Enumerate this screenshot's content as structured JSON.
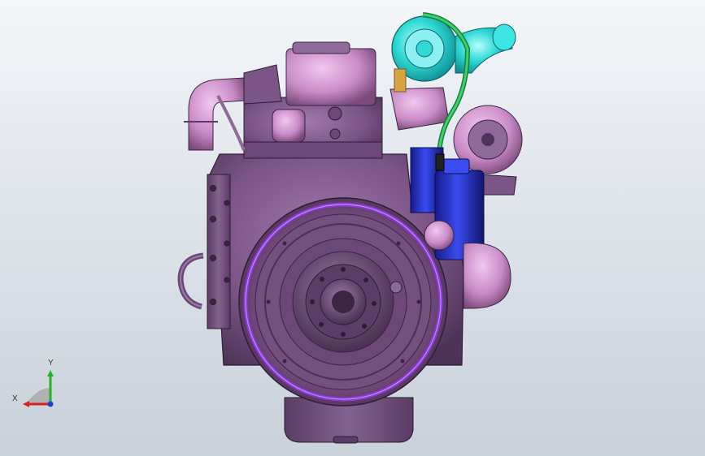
{
  "viewport": {
    "background": "#dfe4ea",
    "model": "diesel-engine-assembly"
  },
  "colors": {
    "block": "#7b5586",
    "block_shadow": "#4e3358",
    "flywheel_ring": "#8a3bd6",
    "turbo": "#2fd9d4",
    "pipe_green": "#38d36a",
    "filter_blue": "#2233cc",
    "pink_parts": "#c98bc6"
  },
  "axis_triad": {
    "x_label": "X",
    "y_label": "Y",
    "x_color": "#d81e1e",
    "y_color": "#22b422",
    "z_color": "#2040d0"
  }
}
